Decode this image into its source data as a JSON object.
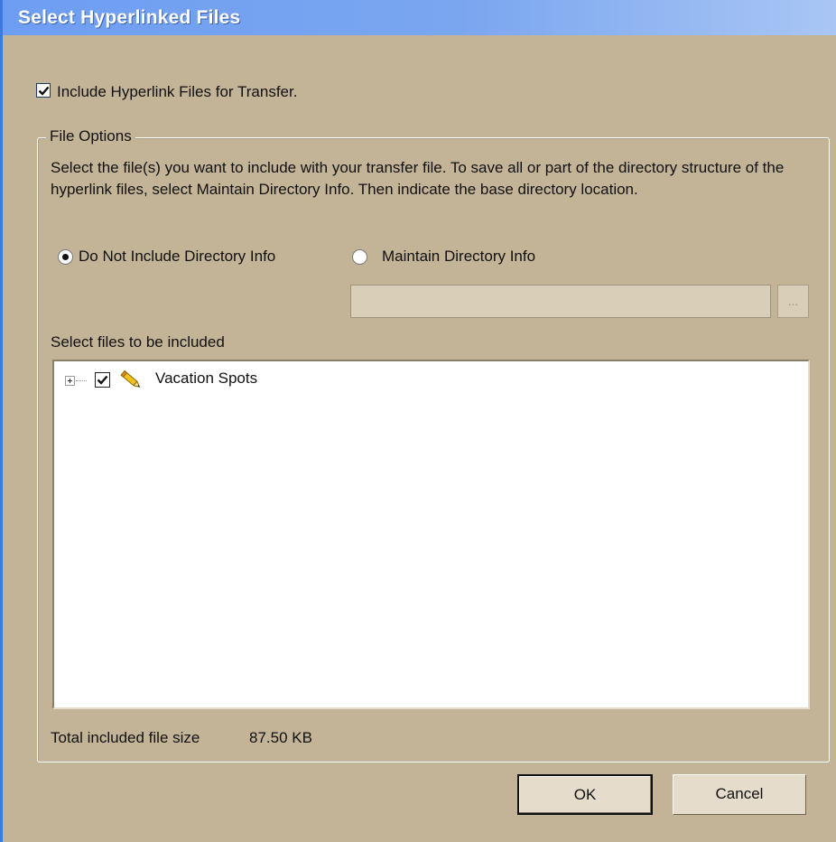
{
  "window": {
    "title": "Select Hyperlinked Files"
  },
  "include_checkbox": {
    "label": "Include Hyperlink Files for Transfer.",
    "checked": true
  },
  "file_options": {
    "group_title": "File Options",
    "description": "Select the file(s) you want to include with your transfer file. To save all or part of the directory structure of the hyperlink files, select Maintain Directory Info. Then indicate the base directory location.",
    "radio_options": [
      {
        "label": "Do Not Include Directory Info",
        "selected": true
      },
      {
        "label": "Maintain Directory Info",
        "selected": false
      }
    ],
    "path_value": "",
    "browse_label": "...",
    "files_label": "Select files to be included",
    "tree_items": [
      {
        "label": "Vacation Spots",
        "checked": true,
        "icon": "pencil-icon",
        "expandable": true
      }
    ],
    "total_size_label": "Total included file size",
    "total_size_value": "87.50 KB"
  },
  "buttons": {
    "ok_label": "OK",
    "cancel_label": "Cancel"
  },
  "colors": {
    "window_bg": "#c4b497",
    "titlebar_start": "#6e9ef2",
    "titlebar_end": "#a9c6f4",
    "title_text": "#ffffff"
  }
}
